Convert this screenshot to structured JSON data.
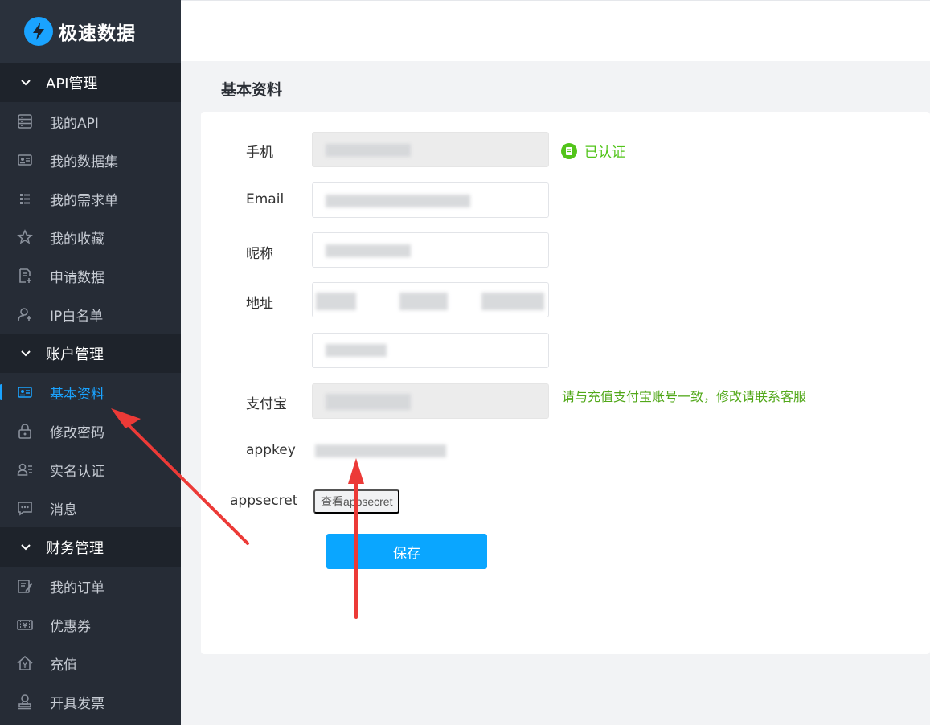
{
  "brand": {
    "name": "极速数据",
    "accent": "#1aa3ff"
  },
  "sidebar": {
    "groups": [
      {
        "title": "API管理",
        "items": [
          {
            "label": "我的API",
            "icon": "server-icon"
          },
          {
            "label": "我的数据集",
            "icon": "id-card-icon"
          },
          {
            "label": "我的需求单",
            "icon": "list-icon"
          },
          {
            "label": "我的收藏",
            "icon": "star-icon"
          },
          {
            "label": "申请数据",
            "icon": "doc-add-icon"
          },
          {
            "label": "IP白名单",
            "icon": "user-add-icon"
          }
        ]
      },
      {
        "title": "账户管理",
        "items": [
          {
            "label": "基本资料",
            "icon": "id-card-icon",
            "active": true
          },
          {
            "label": "修改密码",
            "icon": "lock-icon"
          },
          {
            "label": "实名认证",
            "icon": "user-list-icon"
          },
          {
            "label": "消息",
            "icon": "message-icon"
          }
        ]
      },
      {
        "title": "财务管理",
        "items": [
          {
            "label": "我的订单",
            "icon": "order-icon"
          },
          {
            "label": "优惠券",
            "icon": "coupon-icon"
          },
          {
            "label": "充值",
            "icon": "recharge-icon"
          },
          {
            "label": "开具发票",
            "icon": "invoice-icon"
          }
        ]
      }
    ]
  },
  "page": {
    "title": "基本资料",
    "labels": {
      "phone": "手机",
      "email": "Email",
      "nickname": "昵称",
      "address": "地址",
      "alipay": "支付宝",
      "appkey": "appkey",
      "appsecret": "appsecret"
    },
    "verified_text": "已认证",
    "alipay_hint": "请与充值支付宝账号一致，修改请联系客服",
    "view_secret_label": "查看appsecret",
    "save_label": "保存"
  }
}
